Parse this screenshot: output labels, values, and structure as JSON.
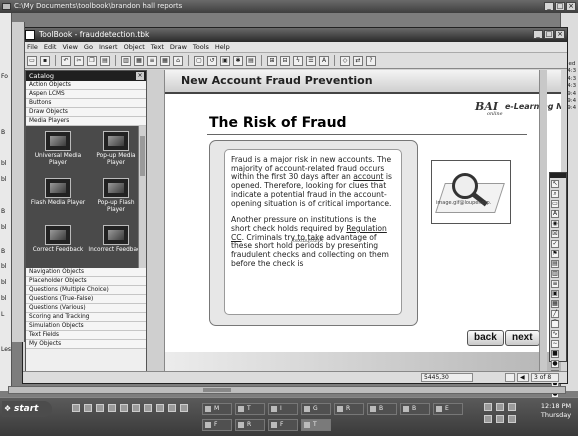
{
  "explorer": {
    "title": "C:\\My Documents\\toolbook\\brandon hall reports",
    "right_column_items": [
      "lified",
      "3 4:3",
      "3 4:3",
      "3 4:3",
      "3 9:4",
      "3 9:4",
      "3 9:4"
    ],
    "left_column_items": [
      "Fo",
      "B",
      "bl",
      "bl",
      "B",
      "bl",
      "B",
      "bl",
      "bl",
      "bl",
      "L",
      "Les"
    ]
  },
  "toolbook": {
    "title": "ToolBook - frauddetection.tbk",
    "menu": [
      "File",
      "Edit",
      "View",
      "Go",
      "Insert",
      "Object",
      "Text",
      "Draw",
      "Tools",
      "Help"
    ],
    "catalog": {
      "header": "Catalog",
      "categories_top": [
        "Action Objects",
        "Aspen LCMS",
        "Buttons",
        "Draw Objects",
        "Media Players"
      ],
      "items": [
        {
          "label": "Universal Media Player"
        },
        {
          "label": "Pop-up Media Player"
        },
        {
          "label": "Flash Media Player"
        },
        {
          "label": "Pop-up Flash Player"
        },
        {
          "label": "Correct Feedback"
        },
        {
          "label": "Incorrect Feedback"
        }
      ],
      "categories_bottom": [
        "Navigation Objects",
        "Placeholder Objects",
        "Questions (Multiple Choice)",
        "Questions (True-False)",
        "Questions (Various)",
        "Scoring and Tracking",
        "Simulation Objects",
        "Text Fields",
        "My Objects"
      ]
    },
    "page": {
      "header": "New Account Fraud Prevention",
      "logo": "BAI",
      "logo_sub": "online",
      "brand": "e-Learning Netwo",
      "title": "The Risk of Fraud",
      "para1_a": "Fraud is a major risk in new accounts. The majority of account-related fraud occurs within the first 30 days after an ",
      "para1_link": "account",
      "para1_b": " is opened. Therefore, looking for clues that indicate a potential fraud in the account-opening situation is of critical importance.",
      "para2_a": "Another pressure on institutions is the short check holds required by ",
      "para2_link": "Regulation CC",
      "para2_b": ". Criminals try to take advantage of these short hold periods by presenting fraudulent checks and collecting on them before the check is",
      "overlay_label": "textbuttonA",
      "image_label": "image.gif@loupehotp.",
      "back_button": "back",
      "next_button": "next"
    },
    "status": {
      "coords": "5445,30",
      "page_indicator": "3 of 8"
    }
  },
  "taskbar": {
    "start": "start",
    "tasks": [
      {
        "label": "M"
      },
      {
        "label": "T"
      },
      {
        "label": "I"
      },
      {
        "label": "G"
      },
      {
        "label": "R"
      },
      {
        "label": "B"
      },
      {
        "label": "B"
      },
      {
        "label": "E"
      },
      {
        "label": "F"
      },
      {
        "label": "R"
      },
      {
        "label": "F"
      },
      {
        "label": "T"
      }
    ],
    "clock_time": "12:18 PM",
    "clock_day": "Thursday"
  }
}
